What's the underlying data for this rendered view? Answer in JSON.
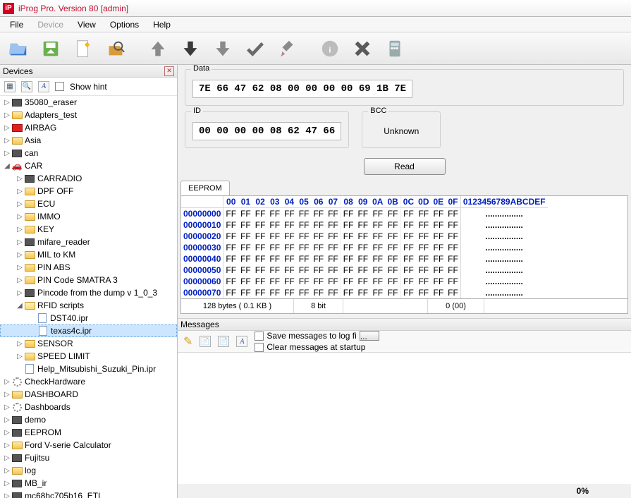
{
  "window": {
    "title": "iProg Pro. Version 80 [admin]"
  },
  "menu": {
    "file": "File",
    "device": "Device",
    "view": "View",
    "options": "Options",
    "help": "Help"
  },
  "devices": {
    "panel_title": "Devices",
    "show_hint": "Show hint",
    "tree": [
      {
        "d": 0,
        "t": "tw",
        "exp": false,
        "ic": "chip",
        "label": "35080_eraser"
      },
      {
        "d": 0,
        "t": "tw",
        "exp": false,
        "ic": "fld",
        "label": "Adapters_test"
      },
      {
        "d": 0,
        "t": "tw",
        "exp": false,
        "ic": "red",
        "label": "AIRBAG"
      },
      {
        "d": 0,
        "t": "tw",
        "exp": false,
        "ic": "fld",
        "label": "Asia"
      },
      {
        "d": 0,
        "t": "tw",
        "exp": false,
        "ic": "chip",
        "label": "can"
      },
      {
        "d": 0,
        "t": "tw",
        "exp": true,
        "ic": "car",
        "label": "CAR"
      },
      {
        "d": 1,
        "t": "tw",
        "exp": false,
        "ic": "chip",
        "label": "CARRADIO"
      },
      {
        "d": 1,
        "t": "tw",
        "exp": false,
        "ic": "fld",
        "label": "DPF OFF"
      },
      {
        "d": 1,
        "t": "tw",
        "exp": false,
        "ic": "fld",
        "label": "ECU"
      },
      {
        "d": 1,
        "t": "tw",
        "exp": false,
        "ic": "fld",
        "label": "IMMO"
      },
      {
        "d": 1,
        "t": "tw",
        "exp": false,
        "ic": "fld",
        "label": "KEY"
      },
      {
        "d": 1,
        "t": "tw",
        "exp": false,
        "ic": "chip",
        "label": "mifare_reader"
      },
      {
        "d": 1,
        "t": "tw",
        "exp": false,
        "ic": "fld",
        "label": "MIL to KM"
      },
      {
        "d": 1,
        "t": "tw",
        "exp": false,
        "ic": "fld",
        "label": "PIN ABS"
      },
      {
        "d": 1,
        "t": "tw",
        "exp": false,
        "ic": "fld",
        "label": "PIN Code SMATRA 3"
      },
      {
        "d": 1,
        "t": "tw",
        "exp": false,
        "ic": "chip",
        "label": "Pincode from the dump v 1_0_3"
      },
      {
        "d": 1,
        "t": "tw",
        "exp": true,
        "ic": "fldo",
        "label": "RFID scripts"
      },
      {
        "d": 2,
        "t": "lf",
        "ic": "doc",
        "label": "DST40.ipr"
      },
      {
        "d": 2,
        "t": "lf",
        "ic": "doc",
        "label": "texas4c.ipr",
        "sel": true
      },
      {
        "d": 1,
        "t": "tw",
        "exp": false,
        "ic": "fld",
        "label": "SENSOR"
      },
      {
        "d": 1,
        "t": "tw",
        "exp": false,
        "ic": "fld",
        "label": "SPEED LIMIT"
      },
      {
        "d": 1,
        "t": "lf",
        "ic": "doc",
        "label": "Help_Mitsubishi_Suzuki_Pin.ipr"
      },
      {
        "d": 0,
        "t": "tw",
        "exp": false,
        "ic": "gear",
        "label": "CheckHardware"
      },
      {
        "d": 0,
        "t": "tw",
        "exp": false,
        "ic": "fld",
        "label": "DASHBOARD"
      },
      {
        "d": 0,
        "t": "tw",
        "exp": false,
        "ic": "gear",
        "label": "Dashboards"
      },
      {
        "d": 0,
        "t": "tw",
        "exp": false,
        "ic": "chip",
        "label": "demo"
      },
      {
        "d": 0,
        "t": "tw",
        "exp": false,
        "ic": "chip",
        "label": "EEPROM"
      },
      {
        "d": 0,
        "t": "tw",
        "exp": false,
        "ic": "fld",
        "label": "Ford V-serie Calculator"
      },
      {
        "d": 0,
        "t": "tw",
        "exp": false,
        "ic": "chip",
        "label": "Fujitsu"
      },
      {
        "d": 0,
        "t": "tw",
        "exp": false,
        "ic": "fld",
        "label": "log"
      },
      {
        "d": 0,
        "t": "tw",
        "exp": false,
        "ic": "chip",
        "label": "MB_ir"
      },
      {
        "d": 0,
        "t": "tw",
        "exp": false,
        "ic": "chip",
        "label": "mc68hc705b16_ETL"
      }
    ]
  },
  "panels": {
    "data_label": "Data",
    "data_value": "7E 66 47 62 08 00 00 00 00 69 1B 7E",
    "id_label": "ID",
    "id_value": "00 00 00 00 08 62 47 66",
    "bcc_label": "BCC",
    "bcc_value": "Unknown",
    "read_btn": "Read"
  },
  "eeprom": {
    "tab": "EEPROM",
    "cols": [
      "00",
      "01",
      "02",
      "03",
      "04",
      "05",
      "06",
      "07",
      "08",
      "09",
      "0A",
      "0B",
      "0C",
      "0D",
      "0E",
      "0F"
    ],
    "ascii_hdr": "0123456789ABCDEF",
    "rows": [
      {
        "off": "00000000",
        "b": [
          "FF",
          "FF",
          "FF",
          "FF",
          "FF",
          "FF",
          "FF",
          "FF",
          "FF",
          "FF",
          "FF",
          "FF",
          "FF",
          "FF",
          "FF",
          "FF"
        ],
        "a": "................"
      },
      {
        "off": "00000010",
        "b": [
          "FF",
          "FF",
          "FF",
          "FF",
          "FF",
          "FF",
          "FF",
          "FF",
          "FF",
          "FF",
          "FF",
          "FF",
          "FF",
          "FF",
          "FF",
          "FF"
        ],
        "a": "................"
      },
      {
        "off": "00000020",
        "b": [
          "FF",
          "FF",
          "FF",
          "FF",
          "FF",
          "FF",
          "FF",
          "FF",
          "FF",
          "FF",
          "FF",
          "FF",
          "FF",
          "FF",
          "FF",
          "FF"
        ],
        "a": "................"
      },
      {
        "off": "00000030",
        "b": [
          "FF",
          "FF",
          "FF",
          "FF",
          "FF",
          "FF",
          "FF",
          "FF",
          "FF",
          "FF",
          "FF",
          "FF",
          "FF",
          "FF",
          "FF",
          "FF"
        ],
        "a": "................"
      },
      {
        "off": "00000040",
        "b": [
          "FF",
          "FF",
          "FF",
          "FF",
          "FF",
          "FF",
          "FF",
          "FF",
          "FF",
          "FF",
          "FF",
          "FF",
          "FF",
          "FF",
          "FF",
          "FF"
        ],
        "a": "................"
      },
      {
        "off": "00000050",
        "b": [
          "FF",
          "FF",
          "FF",
          "FF",
          "FF",
          "FF",
          "FF",
          "FF",
          "FF",
          "FF",
          "FF",
          "FF",
          "FF",
          "FF",
          "FF",
          "FF"
        ],
        "a": "................"
      },
      {
        "off": "00000060",
        "b": [
          "FF",
          "FF",
          "FF",
          "FF",
          "FF",
          "FF",
          "FF",
          "FF",
          "FF",
          "FF",
          "FF",
          "FF",
          "FF",
          "FF",
          "FF",
          "FF"
        ],
        "a": "................"
      },
      {
        "off": "00000070",
        "b": [
          "FF",
          "FF",
          "FF",
          "FF",
          "FF",
          "FF",
          "FF",
          "FF",
          "FF",
          "FF",
          "FF",
          "FF",
          "FF",
          "FF",
          "FF",
          "FF"
        ],
        "a": "................"
      }
    ],
    "status": {
      "size": "128 bytes ( 0.1 KB )",
      "width": "8 bit",
      "pos": "0 (00)"
    }
  },
  "messages": {
    "panel_title": "Messages",
    "save_log": "Save messages to log fi",
    "clear_startup": "Clear messages at startup"
  },
  "footer": {
    "percent": "0%"
  }
}
